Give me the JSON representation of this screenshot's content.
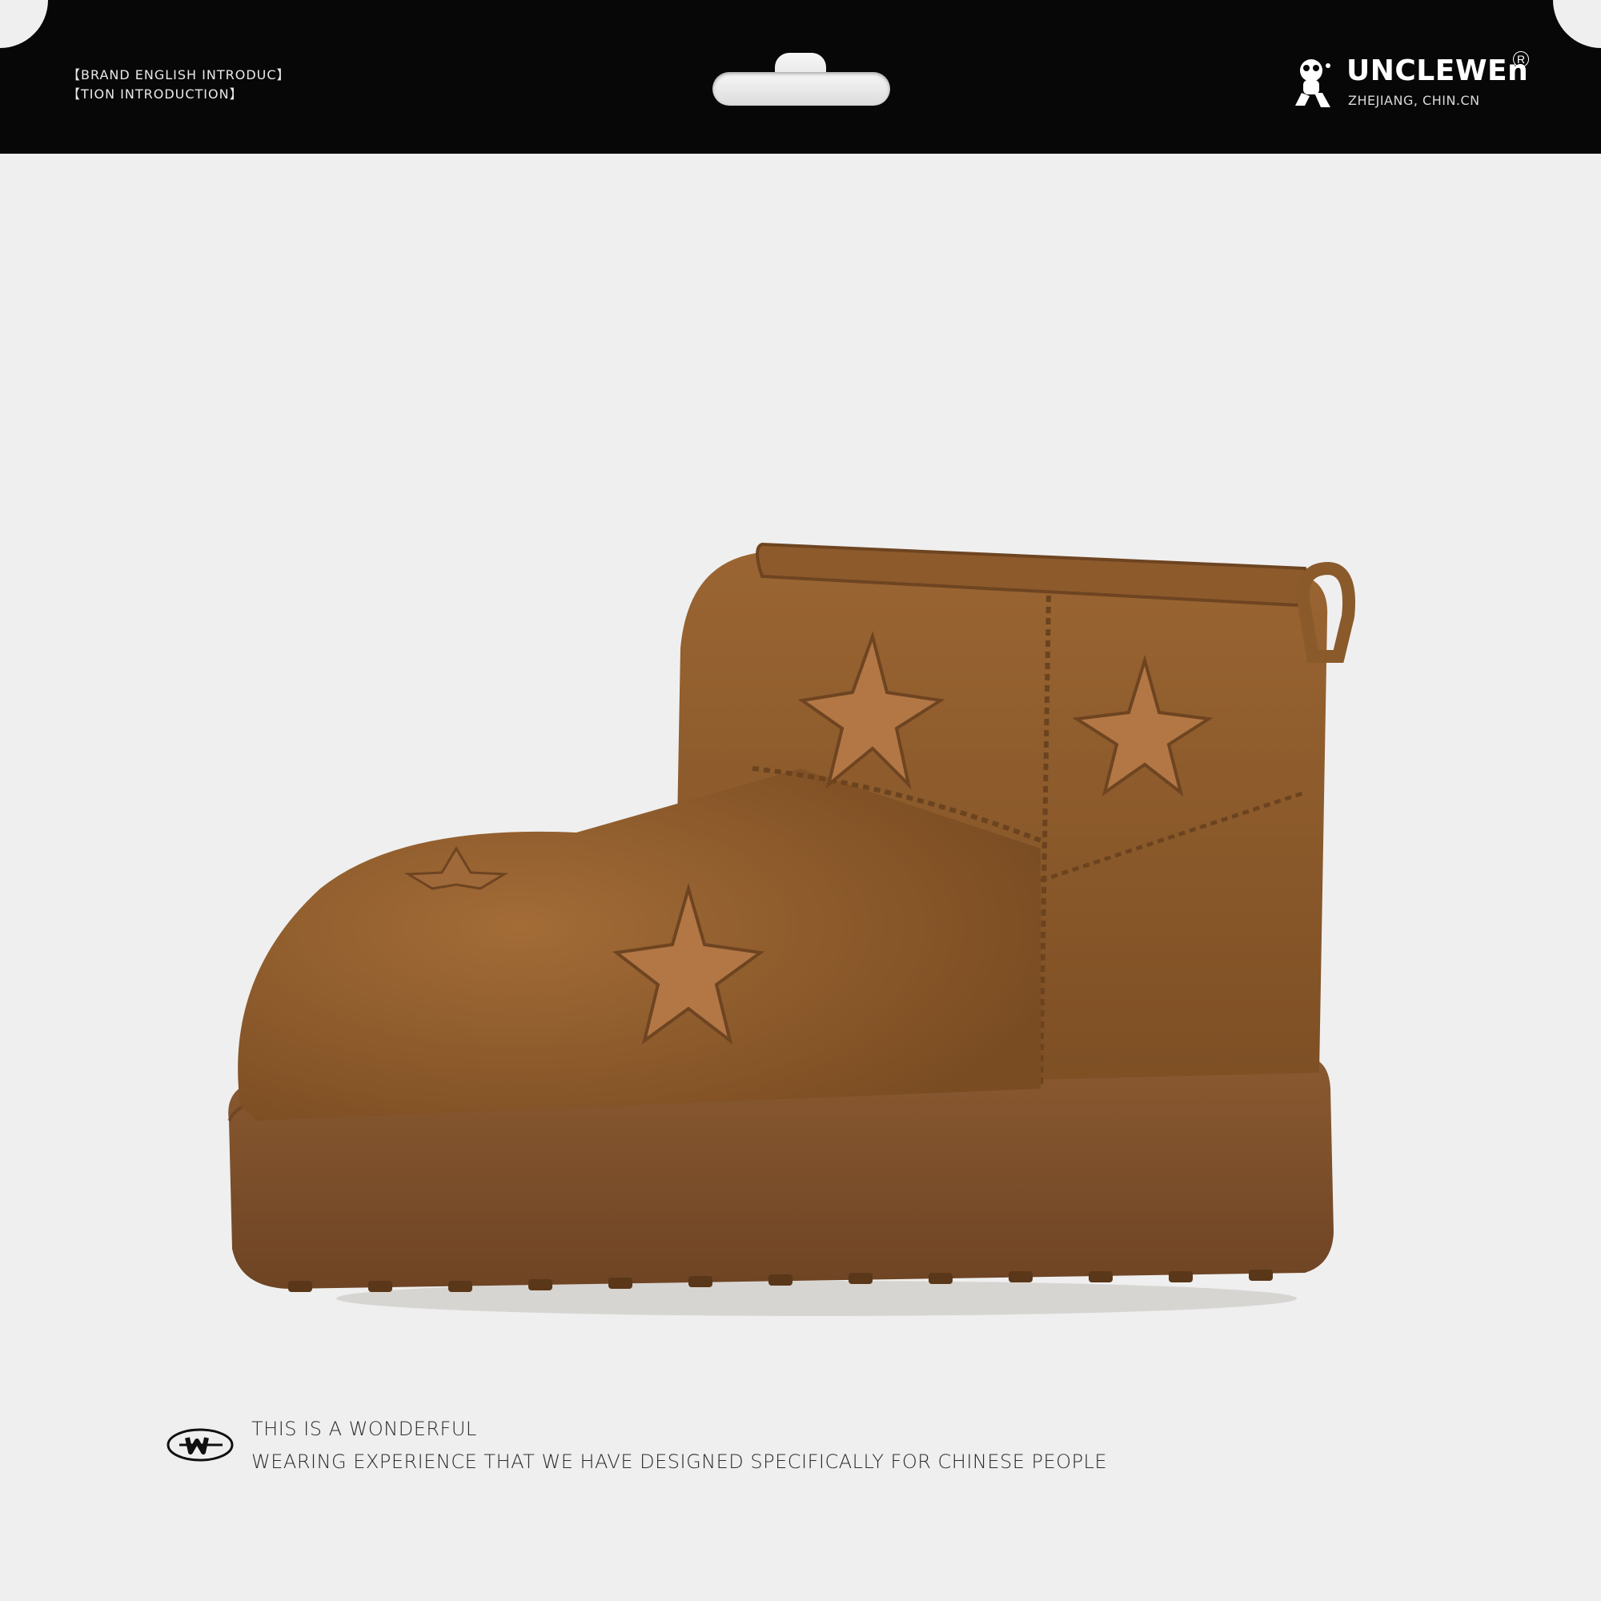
{
  "header": {
    "intro_line_1": "【BRAND ENGLISH INTRODUC】",
    "intro_line_2": "【TION INTRODUCTION】",
    "brand_name": "UNCLEWEn",
    "registered_mark": "R",
    "brand_location": "ZHEJIANG, CHIN.CN"
  },
  "product": {
    "image_icon": "boot-illustration",
    "colors": {
      "suede": "#8a5a2b",
      "sole": "#7a4f2a",
      "star_patch": "#b27744"
    }
  },
  "footer": {
    "badge_icon": "w-badge-icon",
    "line_1": "THIS IS A WONDERFUL",
    "line_2": "WEARING EXPERIENCE THAT WE HAVE DESIGNED SPECIFICALLY FOR CHINESE PEOPLE"
  },
  "colors": {
    "band": "#070707",
    "background": "#efefef"
  }
}
